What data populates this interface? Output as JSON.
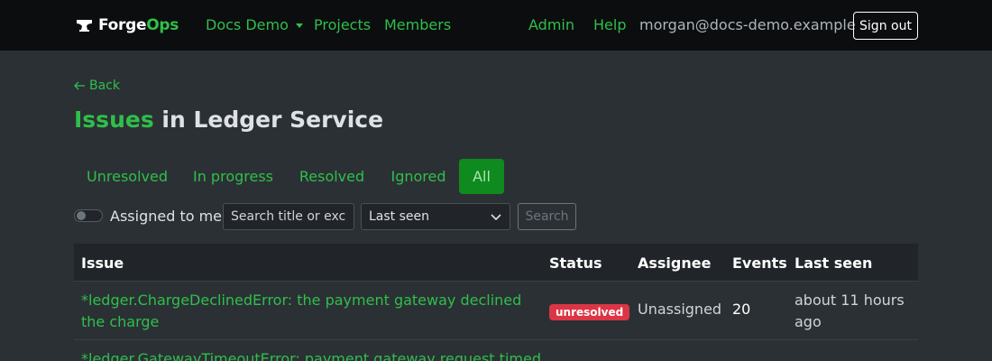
{
  "nav": {
    "brand_part1": "Forge",
    "brand_part2": "Ops",
    "org_dropdown": "Docs Demo",
    "projects": "Projects",
    "members": "Members",
    "admin": "Admin",
    "help": "Help",
    "user_email": "morgan@docs-demo.example",
    "sign_out": "Sign out"
  },
  "page": {
    "back": "Back",
    "title_highlight": "Issues",
    "title_rest": " in Ledger Service"
  },
  "tabs": [
    {
      "label": "Unresolved",
      "active": false
    },
    {
      "label": "In progress",
      "active": false
    },
    {
      "label": "Resolved",
      "active": false
    },
    {
      "label": "Ignored",
      "active": false
    },
    {
      "label": "All",
      "active": true
    }
  ],
  "filters": {
    "assigned_toggle_label": "Assigned to me",
    "assigned_toggle_on": false,
    "search_placeholder": "Search title or exce",
    "sort_selected": "Last seen",
    "search_button": "Search"
  },
  "table": {
    "headers": [
      "Issue",
      "Status",
      "Assignee",
      "Events",
      "Last seen"
    ],
    "rows": [
      {
        "issue": "*ledger.ChargeDeclinedError: the payment gateway declined the charge",
        "status": "unresolved",
        "assignee": "Unassigned",
        "events": "20",
        "last_seen": "about 11 hours ago"
      },
      {
        "issue": "*ledger.GatewayTimeoutError: payment gateway request timed",
        "status": "",
        "assignee": "",
        "events": "",
        "last_seen": ""
      }
    ]
  },
  "colors": {
    "accent": "#2fbf4a",
    "active_tab": "#0f8a1e",
    "danger": "#dc3545",
    "navbar": "#0c0d0e",
    "background": "#2b3035"
  }
}
